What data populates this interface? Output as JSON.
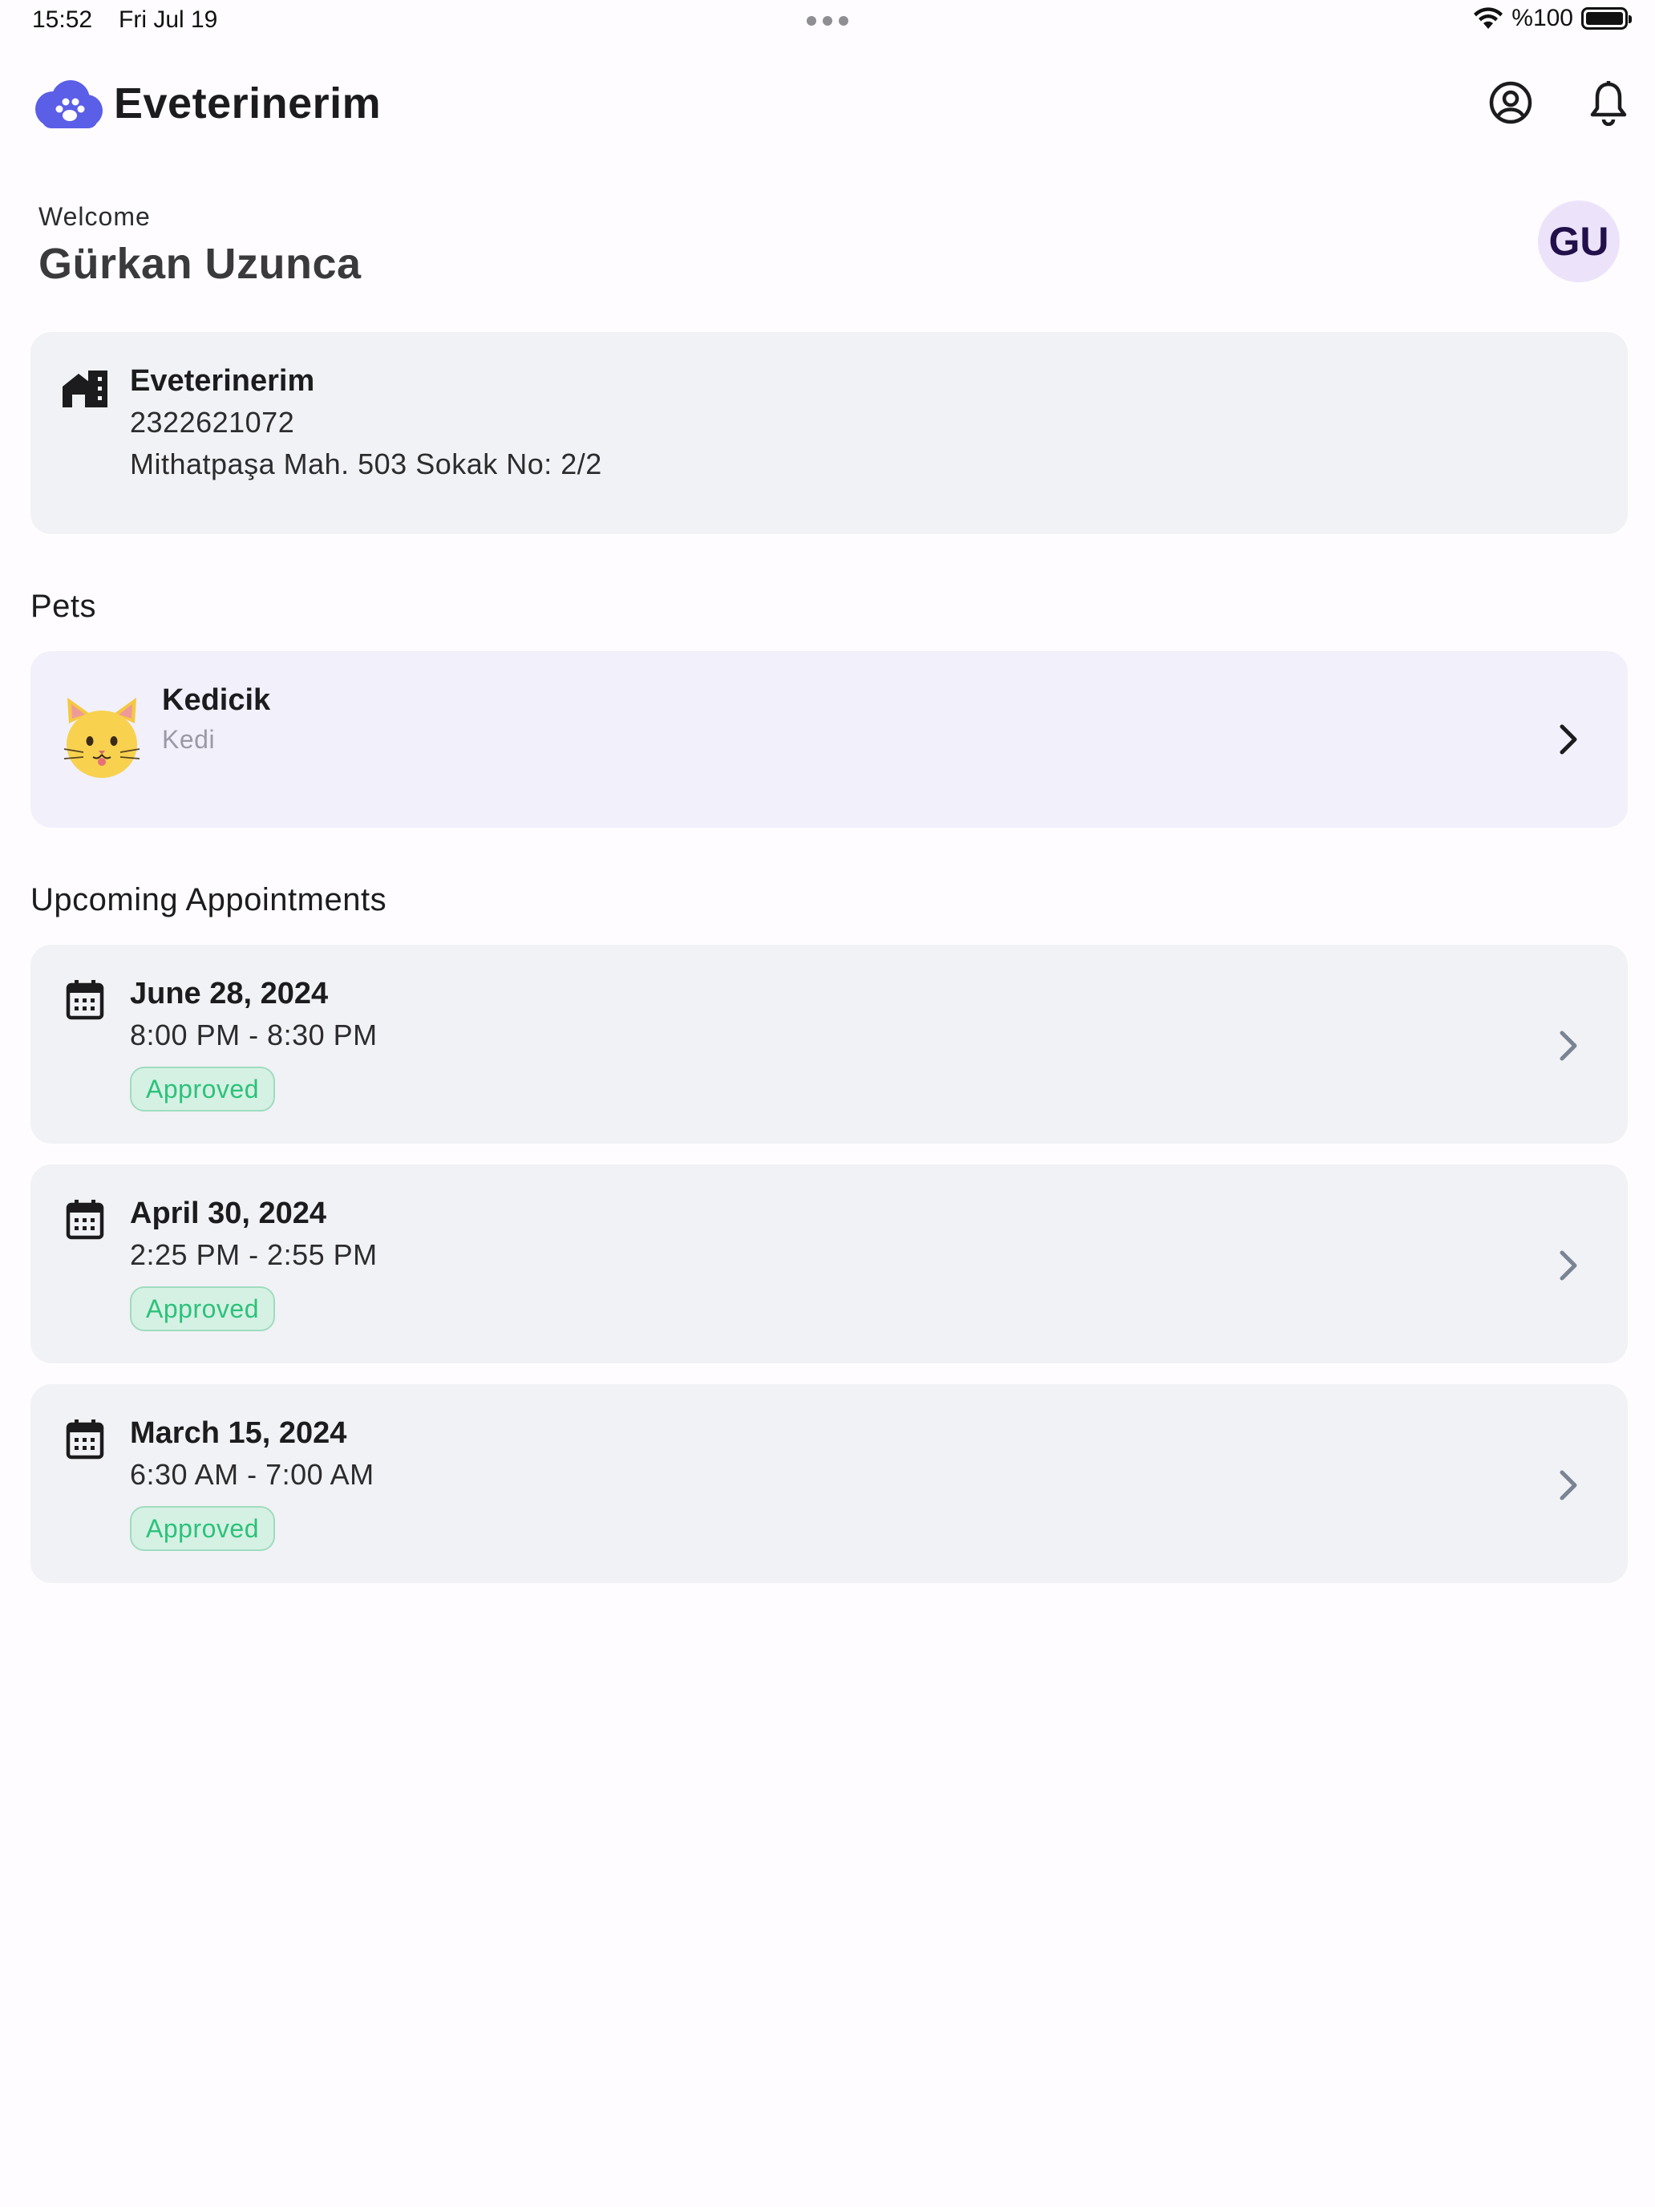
{
  "status_bar": {
    "time": "15:52",
    "date": "Fri Jul 19",
    "battery": "%100"
  },
  "header": {
    "app_title": "Eveterinerim",
    "logo_icon": "paw-cloud-logo",
    "profile_icon": "user-circle-icon",
    "notification_icon": "bell-icon",
    "brand_color": "#5b5ee6"
  },
  "welcome": {
    "label": "Welcome",
    "name": "Gürkan Uzunca",
    "initials": "GU"
  },
  "clinic": {
    "icon": "building-icon",
    "name": "Eveterinerim",
    "phone": "2322621072",
    "address": "Mithatpaşa Mah. 503 Sokak No: 2/2"
  },
  "pets": {
    "section_title": "Pets",
    "items": [
      {
        "name": "Kedicik",
        "type": "Kedi",
        "icon": "cat-face-icon"
      }
    ]
  },
  "appointments": {
    "section_title": "Upcoming Appointments",
    "items": [
      {
        "date": "June 28, 2024",
        "time": "8:00 PM - 8:30 PM",
        "status": "Approved"
      },
      {
        "date": "April 30, 2024",
        "time": "2:25 PM - 2:55 PM",
        "status": "Approved"
      },
      {
        "date": "March 15, 2024",
        "time": "6:30 AM - 7:00 AM",
        "status": "Approved"
      }
    ],
    "status_color": "#2cc27a"
  }
}
